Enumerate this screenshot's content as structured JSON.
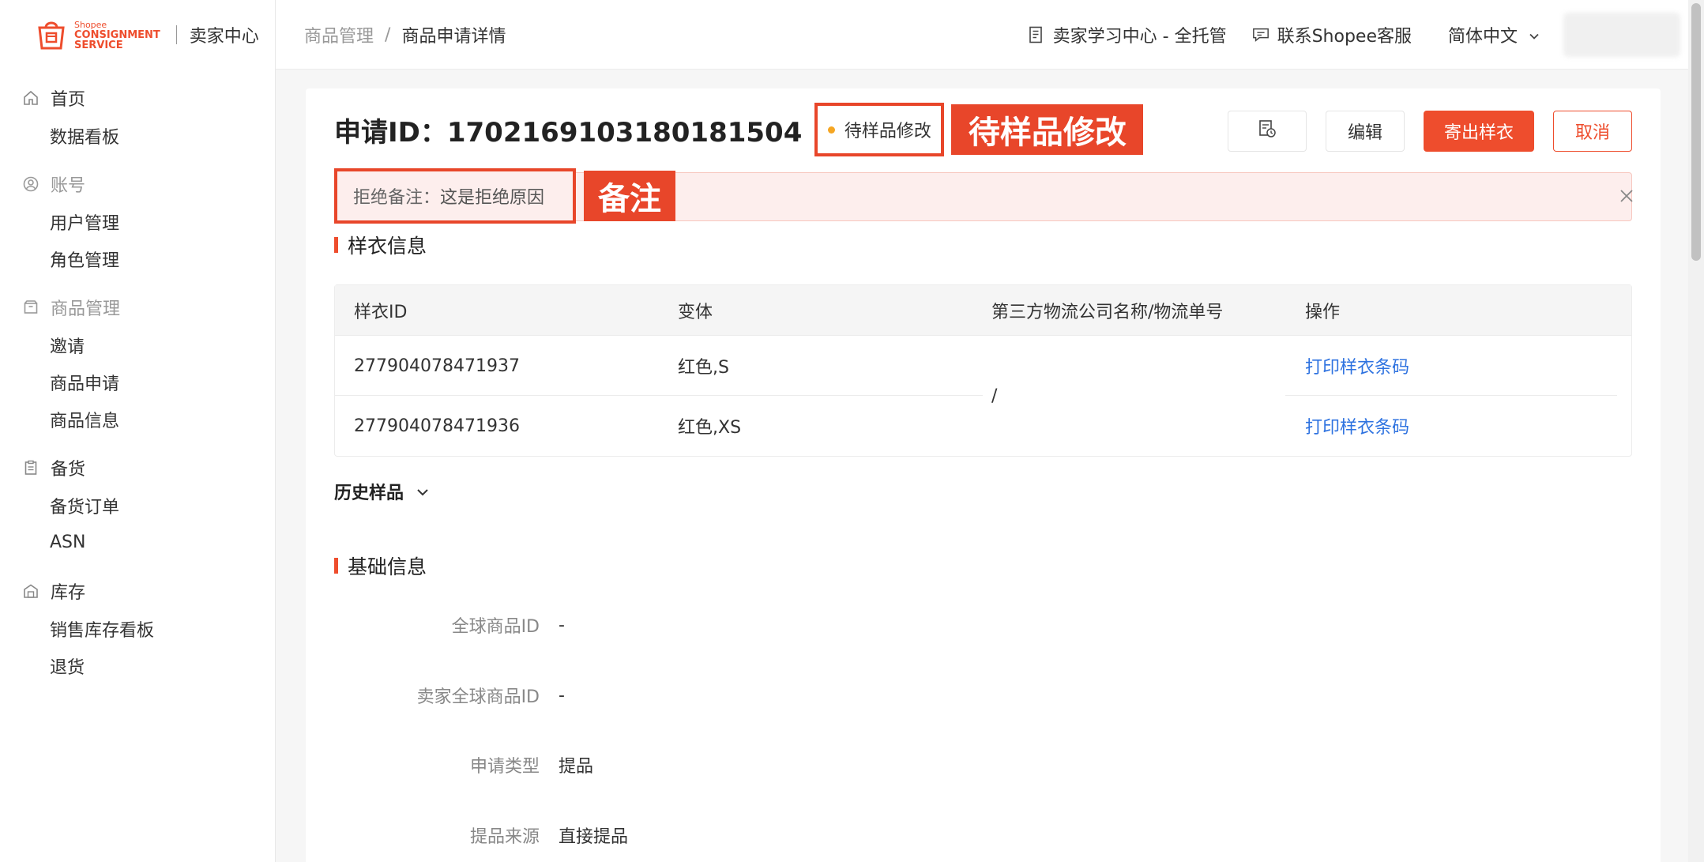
{
  "sidebar": {
    "logo_small": "Shopee",
    "logo_line1": "CONSIGNMENT",
    "logo_line2": "SERVICE",
    "app_title": "卖家中心",
    "groups": [
      {
        "label": "首页",
        "icon": "home-icon",
        "muted": false,
        "items": [
          "数据看板"
        ]
      },
      {
        "label": "账号",
        "icon": "user-icon",
        "muted": true,
        "items": [
          "用户管理",
          "角色管理"
        ]
      },
      {
        "label": "商品管理",
        "icon": "box-icon",
        "muted": true,
        "items": [
          "邀请",
          "商品申请",
          "商品信息"
        ]
      },
      {
        "label": "备货",
        "icon": "clipboard-icon",
        "muted": false,
        "items": [
          "备货订单",
          "ASN"
        ]
      },
      {
        "label": "库存",
        "icon": "warehouse-icon",
        "muted": false,
        "items": [
          "销售库存看板",
          "退货"
        ]
      }
    ]
  },
  "header": {
    "breadcrumb_parent": "商品管理",
    "breadcrumb_sep": "/",
    "breadcrumb_current": "商品申请详情",
    "learning_center": "卖家学习中心 - 全托管",
    "contact_support": "联系Shopee客服",
    "language": "简体中文"
  },
  "detail": {
    "title": "申请ID：1702169103180181504",
    "status": "待样品修改",
    "status_tag": "待样品修改",
    "actions": {
      "edit": "编辑",
      "ship_sample": "寄出样衣",
      "cancel": "取消"
    },
    "alert": {
      "label": "拒绝备注：",
      "text": "这是拒绝原因",
      "tag": "备注"
    }
  },
  "sample_section": {
    "title": "样衣信息",
    "columns": [
      "样衣ID",
      "变体",
      "第三方物流公司名称/物流单号",
      "操作"
    ],
    "rows": [
      {
        "id": "277904078471937",
        "variant": "红色,S",
        "action": "打印样衣条码"
      },
      {
        "id": "277904078471936",
        "variant": "红色,XS",
        "action": "打印样衣条码"
      }
    ],
    "logistics": "/",
    "history": "历史样品"
  },
  "basic_section": {
    "title": "基础信息",
    "fields": [
      {
        "label": "全球商品ID",
        "value": "-"
      },
      {
        "label": "卖家全球商品ID",
        "value": "-"
      },
      {
        "label": "申请类型",
        "value": "提品"
      },
      {
        "label": "提品来源",
        "value": "直接提品"
      }
    ]
  },
  "colors": {
    "brand": "#ee4d2d",
    "annotation": "#e8462a",
    "link": "#2f73e0",
    "status_dot": "#f5a623"
  }
}
